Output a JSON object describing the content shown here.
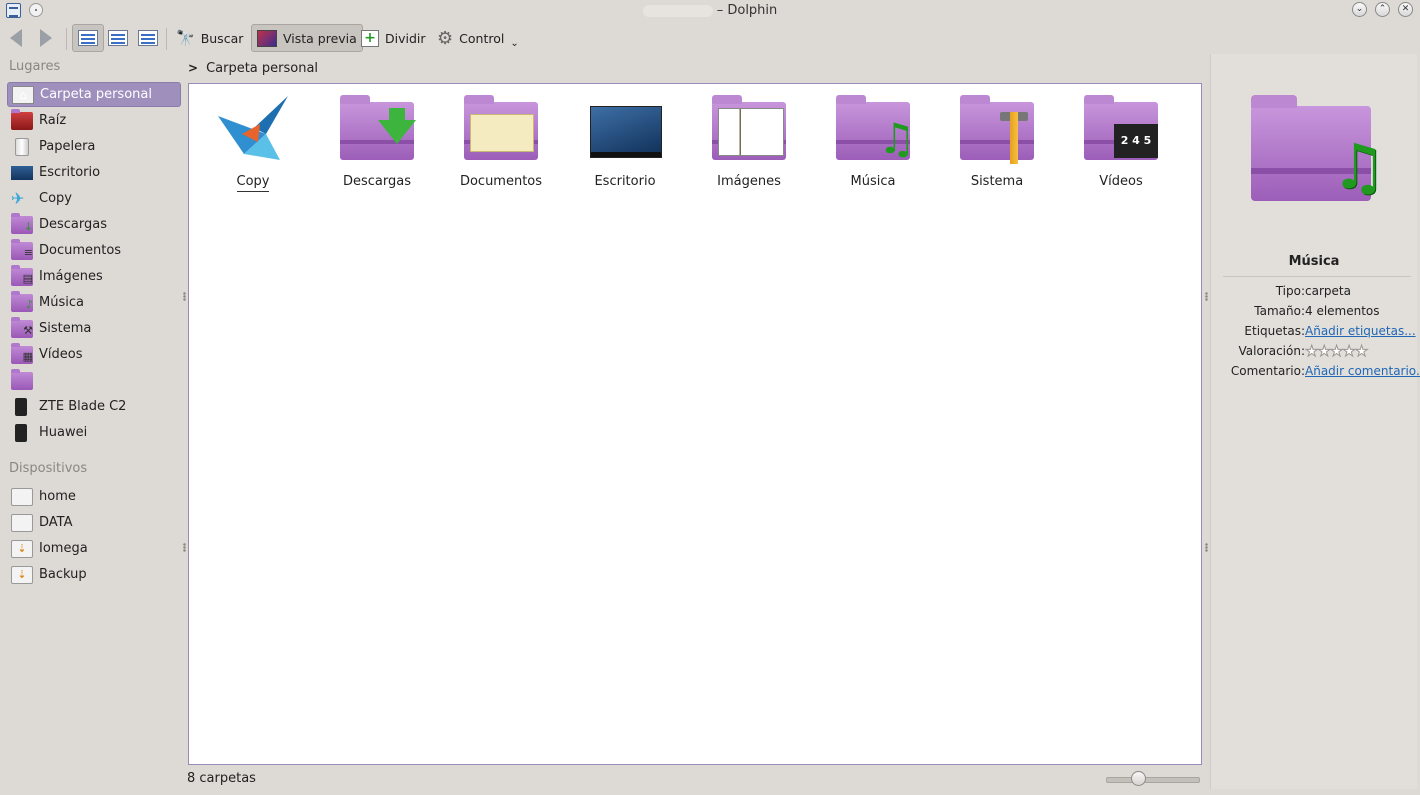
{
  "window": {
    "title": "– Dolphin"
  },
  "toolbar": {
    "search_label": "Buscar",
    "preview_label": "Vista previa",
    "split_label": "Dividir",
    "control_label": "Control"
  },
  "sidebar": {
    "places_heading": "Lugares",
    "places": [
      {
        "label": "Carpeta personal",
        "icon": "home-icon",
        "selected": true
      },
      {
        "label": "Raíz",
        "icon": "root-folder-icon"
      },
      {
        "label": "Papelera",
        "icon": "trash-icon"
      },
      {
        "label": "Escritorio",
        "icon": "desktop-icon"
      },
      {
        "label": "Copy",
        "icon": "copy-bird-icon"
      },
      {
        "label": "Descargas",
        "icon": "downloads-folder-icon"
      },
      {
        "label": "Documentos",
        "icon": "documents-folder-icon"
      },
      {
        "label": "Imágenes",
        "icon": "pictures-folder-icon"
      },
      {
        "label": "Música",
        "icon": "music-folder-icon"
      },
      {
        "label": "Sistema",
        "icon": "system-folder-icon"
      },
      {
        "label": "Vídeos",
        "icon": "videos-folder-icon"
      },
      {
        "label": "",
        "icon": "folder-icon"
      },
      {
        "label": "ZTE Blade C2",
        "icon": "phone-icon"
      },
      {
        "label": "Huawei",
        "icon": "phone-icon"
      }
    ],
    "devices_heading": "Dispositivos",
    "devices": [
      {
        "label": "home",
        "icon": "drive-icon"
      },
      {
        "label": "DATA",
        "icon": "drive-icon"
      },
      {
        "label": "Iomega",
        "icon": "usb-drive-icon"
      },
      {
        "label": "Backup",
        "icon": "usb-drive-icon"
      }
    ]
  },
  "breadcrumb": {
    "current": "Carpeta personal"
  },
  "files": [
    {
      "name": "Copy",
      "icon": "copy-bird-icon"
    },
    {
      "name": "Descargas",
      "icon": "downloads-folder-icon"
    },
    {
      "name": "Documentos",
      "icon": "documents-folder-icon"
    },
    {
      "name": "Escritorio",
      "icon": "desktop-icon"
    },
    {
      "name": "Imágenes",
      "icon": "pictures-folder-icon"
    },
    {
      "name": "Música",
      "icon": "music-folder-icon"
    },
    {
      "name": "Sistema",
      "icon": "system-folder-icon"
    },
    {
      "name": "Vídeos",
      "icon": "videos-folder-icon"
    }
  ],
  "statusbar": {
    "text": "8 carpetas",
    "zoom_fraction": 0.35
  },
  "info_panel": {
    "title": "Música",
    "rows": {
      "type_key": "Tipo:",
      "type_val": "carpeta",
      "size_key": "Tamaño:",
      "size_val": "4 elementos",
      "tags_key": "Etiquetas:",
      "tags_val": "Añadir etiquetas...",
      "rating_key": "Valoración:",
      "rating_val": 0,
      "comment_key": "Comentario:",
      "comment_val": "Añadir comentario..."
    }
  },
  "colors": {
    "selection": "#9f8fbd",
    "folder": "#b074cc",
    "link": "#2167b5"
  }
}
